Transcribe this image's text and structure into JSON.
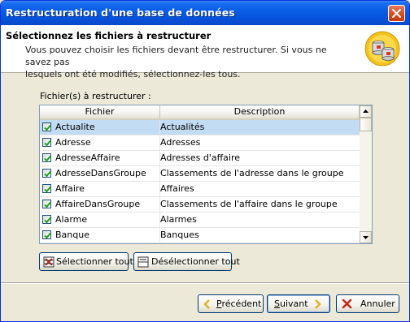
{
  "window": {
    "title": "Restructuration d'une base de données"
  },
  "header": {
    "title": "Sélectionnez les fichiers à restructurer",
    "desc_line1": "Vous pouvez choisir les fichiers devant être restructurer. Si vous ne savez pas",
    "desc_line2": "lesquels ont été modifiés, sélectionnez-les tous."
  },
  "list": {
    "label": "Fichier(s) à restructurer :",
    "columns": [
      "Fichier",
      "Description"
    ],
    "rows": [
      {
        "file": "Actualite",
        "desc": "Actualités",
        "checked": true,
        "selected": true
      },
      {
        "file": "Adresse",
        "desc": "Adresses",
        "checked": true
      },
      {
        "file": "AdresseAffaire",
        "desc": "Adresses d'affaire",
        "checked": true
      },
      {
        "file": "AdresseDansGroupe",
        "desc": "Classements de l'adresse dans le groupe",
        "checked": true
      },
      {
        "file": "Affaire",
        "desc": "Affaires",
        "checked": true
      },
      {
        "file": "AffaireDansGroupe",
        "desc": "Classements de l'affaire dans le groupe",
        "checked": true
      },
      {
        "file": "Alarme",
        "desc": "Alarmes",
        "checked": true
      },
      {
        "file": "Banque",
        "desc": "Banques",
        "checked": true
      }
    ]
  },
  "actions": {
    "select_all": "Sélectionner tout",
    "deselect_all": "Désélectionner tout"
  },
  "nav": {
    "previous": "Précédent",
    "next": "Suivant",
    "cancel": "Annuler"
  }
}
